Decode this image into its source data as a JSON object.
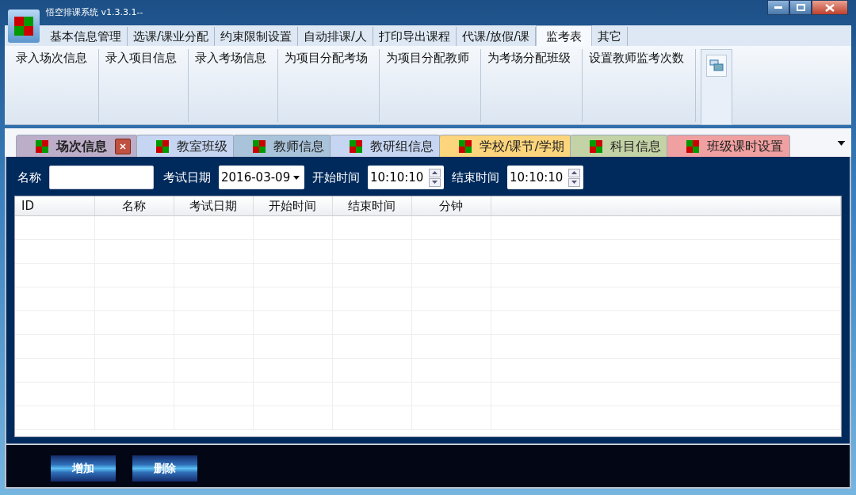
{
  "window": {
    "title": "悟空排课系统 v1.3.3.1--"
  },
  "menu_tabs": [
    {
      "label": "基本信息管理",
      "selected": false
    },
    {
      "label": "选课/课业分配",
      "selected": false
    },
    {
      "label": "约束限制设置",
      "selected": false
    },
    {
      "label": "自动排课/人",
      "selected": false
    },
    {
      "label": "打印导出课程",
      "selected": false
    },
    {
      "label": "代课/放假/课",
      "selected": false
    },
    {
      "label": "监考表",
      "selected": true
    },
    {
      "label": "其它",
      "selected": false
    }
  ],
  "ribbon_items": [
    "录入场次信息",
    "录入项目信息",
    "录入考场信息",
    "为项目分配考场",
    "为项目分配教师",
    "为考场分配班级",
    "设置教师监考次数"
  ],
  "doc_tabs": [
    {
      "label": "场次信息",
      "selected": true,
      "color": "#bcaec8"
    },
    {
      "label": "教室班级",
      "selected": false,
      "color": "#c6d6f2"
    },
    {
      "label": "教师信息",
      "selected": false,
      "color": "#a9c3da"
    },
    {
      "label": "教研组信息",
      "selected": false,
      "color": "#c6d6f2"
    },
    {
      "label": "学校/课节/学期",
      "selected": false,
      "color": "#fdd57c"
    },
    {
      "label": "科目信息",
      "selected": false,
      "color": "#c4d3a6"
    },
    {
      "label": "班级课时设置",
      "selected": false,
      "color": "#f0a0a0"
    }
  ],
  "form": {
    "name_label": "名称",
    "date_label": "考试日期",
    "date_value": "2016-03-09",
    "start_label": "开始时间",
    "start_value": "10:10:10",
    "end_label": "结束时间",
    "end_value": "10:10:10"
  },
  "table": {
    "columns": [
      "ID",
      "名称",
      "考试日期",
      "开始时间",
      "结束时间",
      "分钟"
    ]
  },
  "buttons": [
    "增加",
    "删除"
  ]
}
